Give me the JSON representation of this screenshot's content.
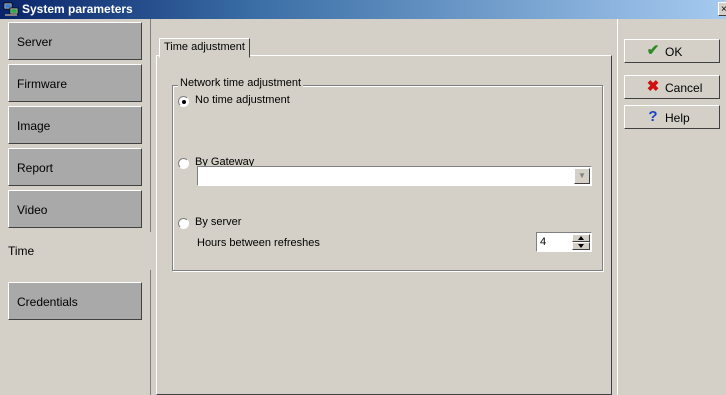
{
  "window": {
    "title": "System parameters",
    "close_glyph": "×"
  },
  "sidebar": {
    "items": [
      {
        "label": "Server"
      },
      {
        "label": "Firmware"
      },
      {
        "label": "Image"
      },
      {
        "label": "Report"
      },
      {
        "label": "Video"
      },
      {
        "label": "Time",
        "active": true
      },
      {
        "label": "Credentials"
      }
    ]
  },
  "main": {
    "tab_label": "Time adjustment",
    "group_label": "Network time adjustment",
    "options": {
      "no_adjust": "No time adjustment",
      "by_gateway": "By Gateway",
      "by_server": "By server"
    },
    "selected_option": "no_adjust",
    "gateway_value": "",
    "hours_label": "Hours between refreshes",
    "hours_value": "4"
  },
  "buttons": {
    "ok": "OK",
    "cancel": "Cancel",
    "help": "Help"
  },
  "colors": {
    "face": "#d4d0c8",
    "nav_inactive": "#a9a9a9",
    "title_start": "#0a246a",
    "ok_icon": "#2e8b22",
    "cancel_icon": "#d01010",
    "help_icon": "#1e40c8"
  },
  "icons": {
    "app": "network-computer-icon",
    "ok": "checkmark-icon",
    "cancel": "x-mark-icon",
    "help": "question-mark-icon"
  }
}
